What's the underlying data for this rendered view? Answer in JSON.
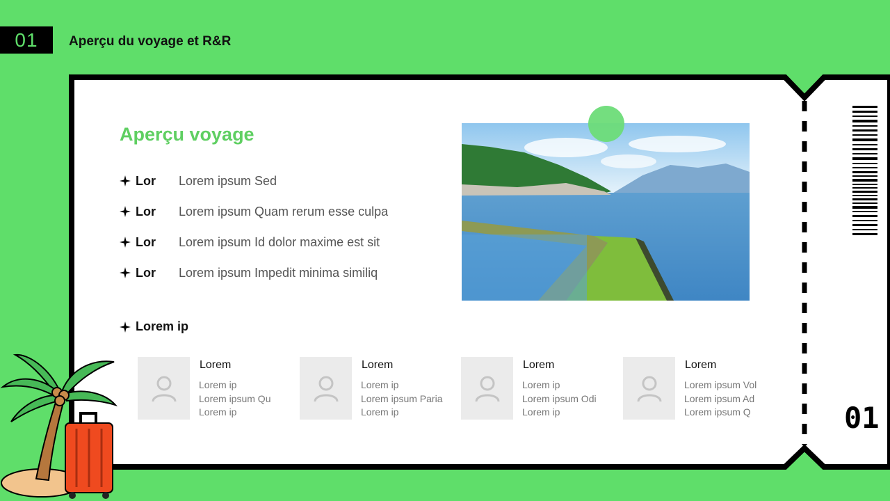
{
  "header": {
    "number": "01",
    "title": "Aperçu du voyage et R&R"
  },
  "overview": {
    "title": "Aperçu voyage",
    "items": [
      {
        "key": "Lor",
        "value": "Lorem ipsum Sed"
      },
      {
        "key": "Lor",
        "value": "Lorem ipsum Quam rerum esse culpa"
      },
      {
        "key": "Lor",
        "value": "Lorem ipsum Id dolor maxime est sit"
      },
      {
        "key": "Lor",
        "value": "Lorem ipsum Impedit minima similiq"
      }
    ]
  },
  "people_section": {
    "heading": "Lorem ip",
    "people": [
      {
        "name": "Lorem",
        "lines": [
          "Lorem ip",
          "Lorem ipsum Qu",
          "Lorem ip"
        ]
      },
      {
        "name": "Lorem",
        "lines": [
          "Lorem ip",
          "Lorem ipsum Paria",
          "Lorem ip"
        ]
      },
      {
        "name": "Lorem",
        "lines": [
          "Lorem ip",
          "Lorem ipsum Odi",
          "Lorem ip"
        ]
      },
      {
        "name": "Lorem",
        "lines": [
          "Lorem ipsum Vol",
          "Lorem ipsum Ad",
          "Lorem ipsum Q"
        ]
      }
    ]
  },
  "ticket": {
    "number": "01"
  },
  "colors": {
    "background": "#5fde6a",
    "accent_title": "#5fcf62",
    "frame": "#000000",
    "panel": "#ffffff"
  },
  "icons": [
    "star-bullet-icon",
    "person-placeholder-icon",
    "barcode-icon",
    "palm-tree-icon",
    "suitcase-icon"
  ]
}
